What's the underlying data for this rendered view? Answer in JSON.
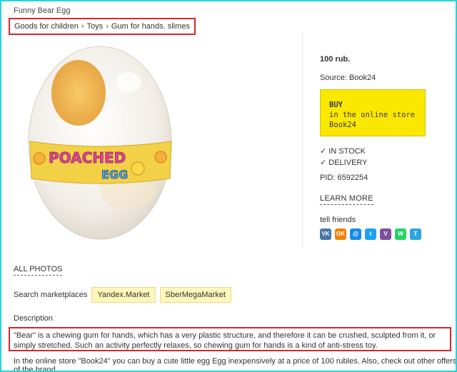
{
  "page": {
    "title": "Funny Bear Egg",
    "breadcrumb": [
      "Goods for children",
      "Toys",
      "Gum for hands. slimes"
    ],
    "breadcrumb_sep": "›"
  },
  "image": {
    "band_text_1": "POACHED",
    "band_text_2": "EGG"
  },
  "offer": {
    "price": "100 rub.",
    "source": "Source: Book24",
    "buy_line1": "BUY",
    "buy_line2": "in the online store",
    "buy_line3": "Book24",
    "in_stock": "✓ IN STOCK",
    "delivery": "✓ DELIVERY",
    "pid": "PID: 6592254",
    "learn_more": "LEARN MORE",
    "tell_friends": "tell friends",
    "buy_color": "#fbe800"
  },
  "social": [
    {
      "name": "vk",
      "glyph": "VK",
      "color": "#4a76a8"
    },
    {
      "name": "odnoklassniki",
      "glyph": "OK",
      "color": "#ee8208"
    },
    {
      "name": "moimir",
      "glyph": "@",
      "color": "#168de2"
    },
    {
      "name": "twitter",
      "glyph": "t",
      "color": "#1da1f2"
    },
    {
      "name": "viber",
      "glyph": "V",
      "color": "#7b519d"
    },
    {
      "name": "whatsapp",
      "glyph": "W",
      "color": "#25d366"
    },
    {
      "name": "telegram",
      "glyph": "T",
      "color": "#2ca5e0"
    }
  ],
  "gallery": {
    "all_photos": "ALL PHOTOS"
  },
  "marketplaces": {
    "label": "Search marketplaces",
    "items": [
      "Yandex.Market",
      "SberMegaMarket"
    ]
  },
  "description": {
    "title": "Description",
    "text": "\"Bear\" is a chewing gum for hands, which has a very plastic structure, and therefore it can be crushed, sculpted from it, or simply stretched. Such an activity perfectly relaxes, so chewing gum for hands is a kind of anti-stress toy.",
    "more": "In the online store \"Book24\" you can buy a cute little egg Egg inexpensively at a price of 100 rubles. Also, check out other offers of the brand."
  }
}
